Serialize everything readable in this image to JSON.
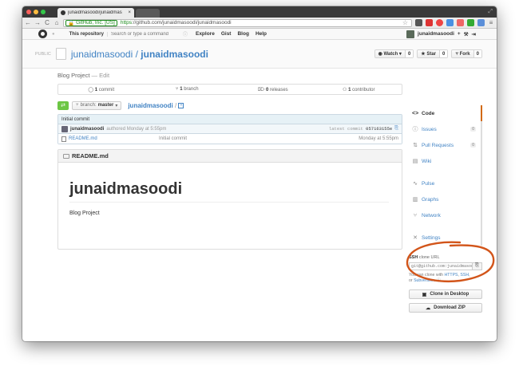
{
  "browser": {
    "tab_title": "junaidmasoodi/junaidmas",
    "ssl_label": "GitHub, Inc. [US]",
    "url_scheme": "https",
    "url_rest": "://github.com/junaidmasoodi/junaidmasoodi"
  },
  "header": {
    "scope": "This repository",
    "search_placeholder": "Search or type a command",
    "nav": [
      "Explore",
      "Gist",
      "Blog",
      "Help"
    ],
    "username": "junaidmasoodi",
    "plus": "+",
    "tools": "⚒",
    "signout": "⇥"
  },
  "repo": {
    "visibility": "PUBLIC",
    "owner": "junaidmasoodi",
    "sep": " / ",
    "name": "junaidmasoodi",
    "watch_label": "Watch",
    "watch_count": "0",
    "star_label": "Star",
    "star_count": "0",
    "fork_label": "Fork",
    "fork_count": "0"
  },
  "main": {
    "description": "Blog Project",
    "edit_label": "— Edit",
    "stats": {
      "commits_count": "1",
      "commits_label": "commit",
      "branches_count": "1",
      "branches_label": "branch",
      "releases_count": "0",
      "releases_label": "releases",
      "contributors_count": "1",
      "contributors_label": "contributor"
    },
    "branch_prefix": "branch:",
    "branch_name": "master",
    "path_root": "junaidmasoodi",
    "path_sep": "/",
    "commit_message": "Initial commit",
    "commit_author": "junaidmasoodi",
    "commit_when": "authored Monday at 5:55pm",
    "commit_sha_label": "latest commit",
    "commit_sha": "057163155e",
    "files": [
      {
        "name": "README.md",
        "message": "Initial commit",
        "age": "Monday at 5:55pm"
      }
    ],
    "readme_title": "README.md",
    "readme_h1": "junaidmasoodi",
    "readme_p": "Blog Project"
  },
  "sidebar": {
    "items": [
      {
        "icon": "<>",
        "label": "Code",
        "count": ""
      },
      {
        "icon": "ⓘ",
        "label": "Issues",
        "count": "0"
      },
      {
        "icon": "⇅",
        "label": "Pull Requests",
        "count": "0"
      },
      {
        "icon": "▤",
        "label": "Wiki",
        "count": ""
      },
      {
        "icon": "∿",
        "label": "Pulse",
        "count": ""
      },
      {
        "icon": "▥",
        "label": "Graphs",
        "count": ""
      },
      {
        "icon": "⑂",
        "label": "Network",
        "count": ""
      },
      {
        "icon": "✕",
        "label": "Settings",
        "count": ""
      }
    ],
    "ssh_label": "SSH",
    "ssh_suffix": "clone URL",
    "ssh_value": "git@github.com:junaidmasoodi/junaidmasoodi.git",
    "clone_note_prefix": "You can clone with ",
    "clone_https": "HTTPS",
    "clone_sep": ", ",
    "clone_ssh": "SSH",
    "clone_or": ",",
    "clone_or_word": "or",
    "clone_svn": "Subversion",
    "clone_desktop": "Clone in Desktop",
    "download_zip": "Download ZIP"
  },
  "colors": {
    "link": "#4183c4",
    "annotation": "#d2551a",
    "compare_green": "#6cc644"
  }
}
